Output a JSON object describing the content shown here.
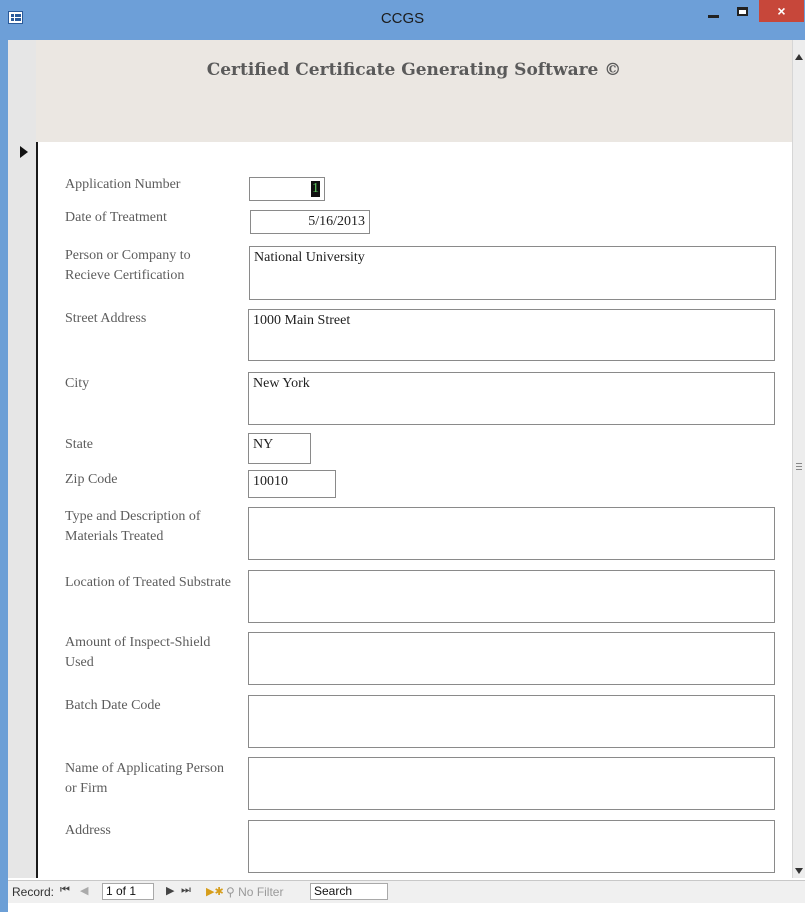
{
  "window": {
    "title": "CCGS",
    "close_glyph": "×"
  },
  "header": {
    "title": "Certified Certificate Generating Software ©"
  },
  "form": {
    "application_number": {
      "label": "Application Number",
      "value": "1"
    },
    "date_of_treatment": {
      "label": "Date of Treatment",
      "value": "5/16/2013"
    },
    "recipient": {
      "label_line1": "Person or Company to",
      "label_line2": "Recieve Certification",
      "value": "National University"
    },
    "street_address": {
      "label": "Street Address",
      "value": "1000 Main Street"
    },
    "city": {
      "label": "City",
      "value": "New York"
    },
    "state": {
      "label": "State",
      "value": "NY"
    },
    "zip_code": {
      "label": "Zip Code",
      "value": "10010"
    },
    "materials": {
      "label_line1": "Type and Description of",
      "label_line2": "Materials Treated",
      "value": ""
    },
    "location": {
      "label": "Location of Treated Substrate",
      "value": ""
    },
    "amount": {
      "label_line1": "Amount of Inspect-Shield",
      "label_line2": "Used",
      "value": ""
    },
    "batch_date_code": {
      "label": "Batch Date Code",
      "value": ""
    },
    "applicator_name": {
      "label_line1": "Name of Applicating Person",
      "label_line2": "or Firm",
      "value": ""
    },
    "address": {
      "label": "Address",
      "value": ""
    }
  },
  "navigation": {
    "record_label": "Record:",
    "first_glyph": "⏮",
    "prev_glyph": "◀",
    "position": "1 of 1",
    "next_glyph": "▶",
    "last_glyph": "⏭",
    "new_glyph": "▶✱",
    "filter_label": "No Filter",
    "search_label": "Search"
  }
}
